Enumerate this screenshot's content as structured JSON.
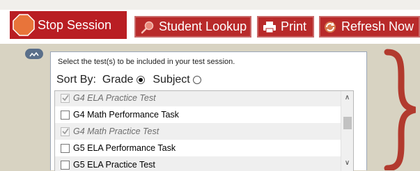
{
  "toolbar": {
    "stop_label": "Stop Session",
    "lookup_label": "Student Lookup",
    "print_label": "Print",
    "refresh_label": "Refresh Now"
  },
  "panel": {
    "instruction": "Select the test(s) to be included in your test session.",
    "sort_by_label": "Sort By:",
    "sort_options": [
      {
        "label": "Grade",
        "selected": true
      },
      {
        "label": "Subject",
        "selected": false
      }
    ],
    "tests": [
      {
        "label": "G4 ELA Practice Test",
        "checked": true,
        "disabled": true
      },
      {
        "label": "G4 Math Performance Task",
        "checked": false,
        "disabled": false
      },
      {
        "label": "G4 Math Practice Test",
        "checked": true,
        "disabled": true
      },
      {
        "label": "G5 ELA Performance Task",
        "checked": false,
        "disabled": false
      },
      {
        "label": "G5 ELA Practice Test",
        "checked": false,
        "disabled": false
      }
    ]
  },
  "colors": {
    "button_red": "#b82a2a",
    "stop_red": "#b91e23",
    "brace_red": "#b23a2e",
    "background_tan": "#d8d3c2"
  },
  "icons": [
    "stop-sign-icon",
    "magnifier-icon",
    "printer-icon",
    "refresh-icon",
    "collapse-chevron-icon",
    "checkbox-icon",
    "radio-icon"
  ]
}
